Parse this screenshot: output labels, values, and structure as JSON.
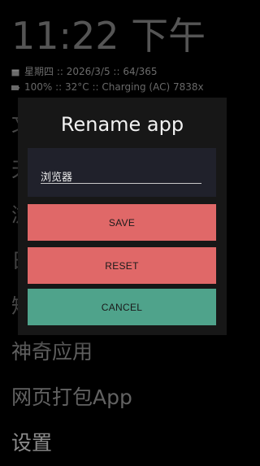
{
  "clock": "11:22 下午",
  "status": {
    "line1": "星期四 :: 2026/3/5 :: 64/365",
    "line2": "100% :: 32°C :: Charging (AC) 7838x"
  },
  "background_list": [
    "文",
    "天",
    "浏",
    "日",
    "短",
    "神奇应用",
    "网页打包App",
    "设置"
  ],
  "dialog": {
    "title": "Rename app",
    "input_value": "浏览器",
    "save_label": "SAVE",
    "reset_label": "RESET",
    "cancel_label": "CANCEL"
  },
  "colors": {
    "save": "#e06868",
    "reset": "#e06868",
    "cancel": "#4fa38b"
  }
}
